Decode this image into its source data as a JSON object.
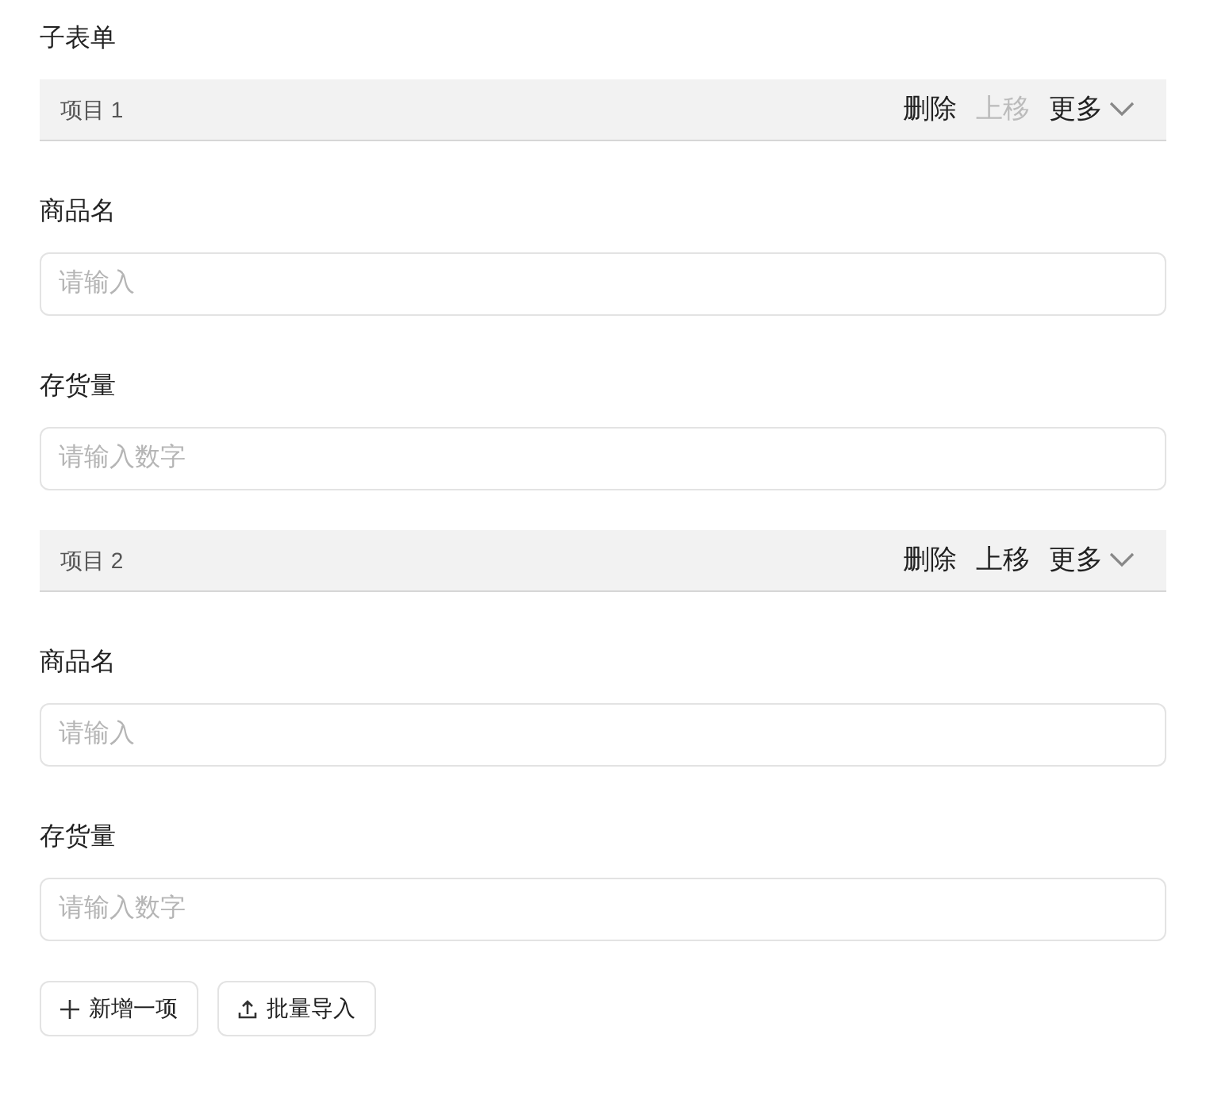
{
  "title": "子表单",
  "items": [
    {
      "label": "项目 1",
      "actions": [
        {
          "label": "删除",
          "disabled": false
        },
        {
          "label": "上移",
          "disabled": true
        },
        {
          "label": "更多",
          "disabled": false,
          "kind": "dropdown"
        }
      ],
      "fields": [
        {
          "label": "商品名",
          "placeholder": "请输入"
        },
        {
          "label": "存货量",
          "placeholder": "请输入数字"
        }
      ]
    },
    {
      "label": "项目 2",
      "actions": [
        {
          "label": "删除",
          "disabled": false
        },
        {
          "label": "上移",
          "disabled": false
        },
        {
          "label": "更多",
          "disabled": false,
          "kind": "dropdown"
        }
      ],
      "fields": [
        {
          "label": "商品名",
          "placeholder": "请输入"
        },
        {
          "label": "存货量",
          "placeholder": "请输入数字"
        }
      ]
    }
  ],
  "buttons": [
    {
      "label": "新增一项",
      "kind": "add"
    },
    {
      "label": "批量导入",
      "kind": "import"
    }
  ]
}
